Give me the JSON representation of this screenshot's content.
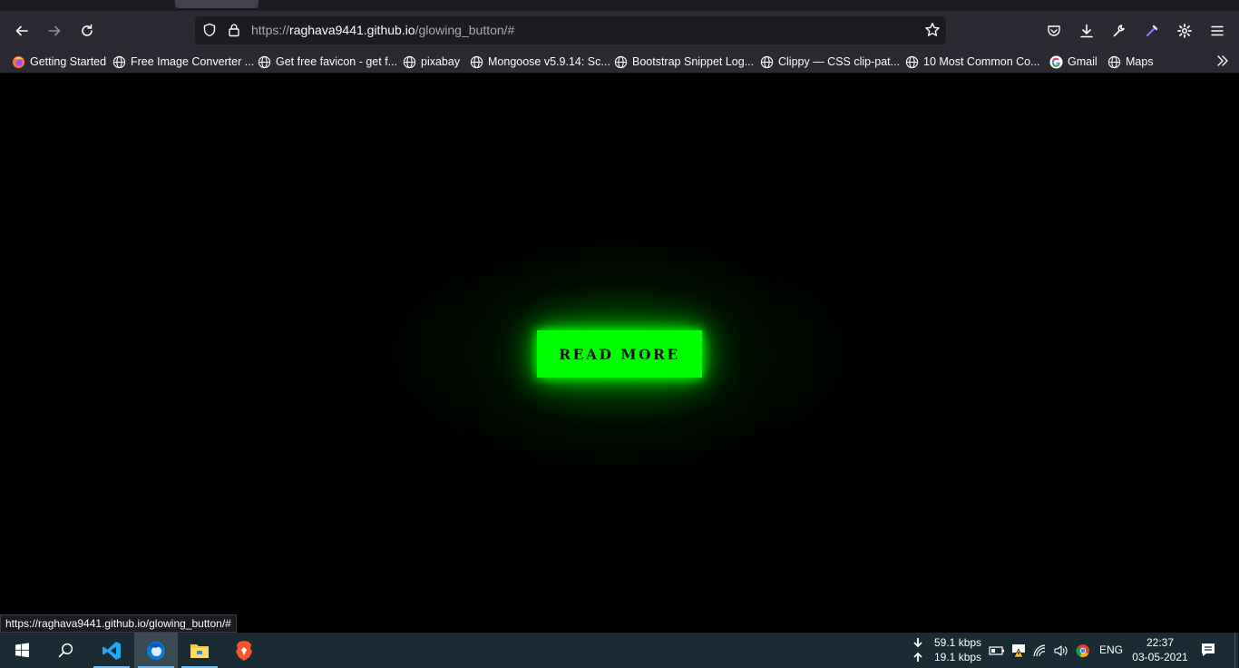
{
  "browser": {
    "url_prefix": "https://",
    "url_host": "raghava9441.github.io",
    "url_path": "/glowing_button/#",
    "bookmarks": [
      {
        "label": "Getting Started",
        "icon": "firefox-icon"
      },
      {
        "label": "Free Image Converter ...",
        "icon": "globe-icon"
      },
      {
        "label": "Get free favicon - get f...",
        "icon": "globe-icon"
      },
      {
        "label": "pixabay",
        "icon": "globe-icon"
      },
      {
        "label": "Mongoose v5.9.14: Sc...",
        "icon": "globe-icon"
      },
      {
        "label": "Bootstrap Snippet Log...",
        "icon": "globe-icon"
      },
      {
        "label": "Clippy — CSS clip-pat...",
        "icon": "globe-icon"
      },
      {
        "label": "10 Most Common Co...",
        "icon": "globe-icon"
      },
      {
        "label": "Gmail",
        "icon": "google-icon"
      },
      {
        "label": "Maps",
        "icon": "globe-icon"
      }
    ],
    "status_link": "https://raghava9441.github.io/glowing_button/#"
  },
  "page": {
    "button_label": "READ MORE",
    "button_color": "#00ff00"
  },
  "taskbar": {
    "download_speed": "59.1 kbps",
    "upload_speed": "19.1 kbps",
    "language": "ENG",
    "time": "22:37",
    "date": "03-05-2021"
  }
}
